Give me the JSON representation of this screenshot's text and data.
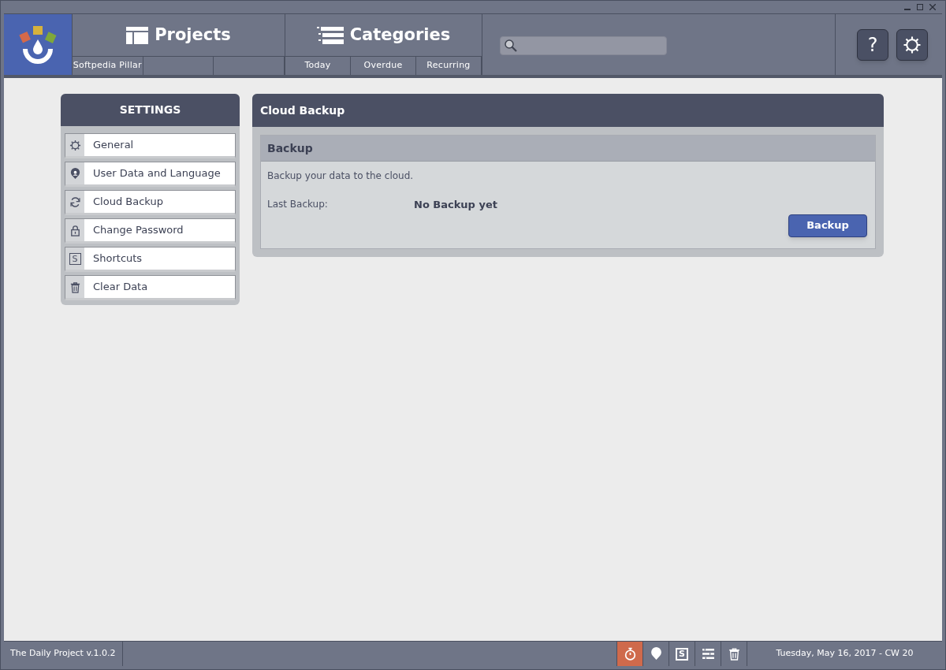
{
  "header": {
    "projects": {
      "title": "Projects",
      "tabs": [
        "Softpedia Pillar"
      ]
    },
    "categories": {
      "title": "Categories",
      "tabs": [
        "Today",
        "Overdue",
        "Recurring"
      ]
    },
    "buttons": [
      {
        "kind": "help",
        "glyph": "?"
      },
      {
        "kind": "settings"
      }
    ]
  },
  "settings": {
    "title": "SETTINGS",
    "items": [
      {
        "kind": "general",
        "label": "General"
      },
      {
        "kind": "user",
        "label": "User Data and Language"
      },
      {
        "kind": "sync",
        "label": "Cloud Backup"
      },
      {
        "kind": "lock",
        "label": "Change Password"
      },
      {
        "kind": "shortcuts",
        "label": "Shortcuts",
        "glyph": "S"
      },
      {
        "kind": "trash",
        "label": "Clear Data"
      }
    ]
  },
  "panel": {
    "title": "Cloud Backup",
    "section": {
      "title": "Backup",
      "description": "Backup your data to the cloud.",
      "label": "Last Backup:",
      "value": "No Backup yet",
      "button": "Backup"
    }
  },
  "status_bar": {
    "version": "The Daily Project v.1.0.2",
    "icons": [
      {
        "kind": "timer",
        "active": true
      },
      {
        "kind": "user",
        "active": false
      },
      {
        "kind": "shortcuts",
        "glyph": "S",
        "active": false
      },
      {
        "kind": "list",
        "active": false
      },
      {
        "kind": "trash",
        "active": false
      }
    ],
    "date": "Tuesday, May 16, 2017 - CW 20"
  }
}
